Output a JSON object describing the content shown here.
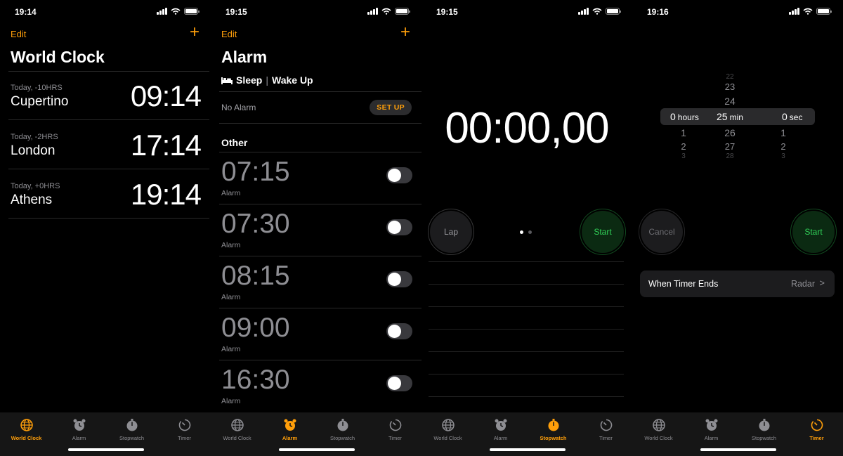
{
  "accent": "#ff9f0a",
  "tabs": [
    "World Clock",
    "Alarm",
    "Stopwatch",
    "Timer"
  ],
  "worldclock": {
    "status_time": "19:14",
    "edit": "Edit",
    "plus": "+",
    "title": "World Clock",
    "cities": [
      {
        "offset": "Today, -10HRS",
        "city": "Cupertino",
        "time": "09:14"
      },
      {
        "offset": "Today, -2HRS",
        "city": "London",
        "time": "17:14"
      },
      {
        "offset": "Today, +0HRS",
        "city": "Athens",
        "time": "19:14"
      }
    ]
  },
  "alarm": {
    "status_time": "19:15",
    "edit": "Edit",
    "plus": "+",
    "title": "Alarm",
    "sleep_label": "Sleep",
    "sleep_sep": "|",
    "wake_label": "Wake Up",
    "no_alarm": "No Alarm",
    "setup": "SET UP",
    "other": "Other",
    "alarms": [
      {
        "time": "07:15",
        "label": "Alarm",
        "on": false
      },
      {
        "time": "07:30",
        "label": "Alarm",
        "on": false
      },
      {
        "time": "08:15",
        "label": "Alarm",
        "on": false
      },
      {
        "time": "09:00",
        "label": "Alarm",
        "on": false
      },
      {
        "time": "16:30",
        "label": "Alarm",
        "on": false
      }
    ]
  },
  "stopwatch": {
    "status_time": "19:15",
    "display": "00:00,00",
    "lap": "Lap",
    "start": "Start"
  },
  "timer": {
    "status_time": "19:16",
    "hours_above": [],
    "hours": "0",
    "hours_unit": "hours",
    "hours_below": [
      "1",
      "2",
      "3"
    ],
    "min_above": [
      "22",
      "23",
      "24"
    ],
    "min": "25",
    "min_unit": "min",
    "min_below": [
      "26",
      "27",
      "28"
    ],
    "sec": "0",
    "sec_unit": "sec",
    "sec_below": [
      "1",
      "2",
      "3"
    ],
    "cancel": "Cancel",
    "start": "Start",
    "when_label": "When Timer Ends",
    "when_value": "Radar",
    "chevron": ">"
  }
}
